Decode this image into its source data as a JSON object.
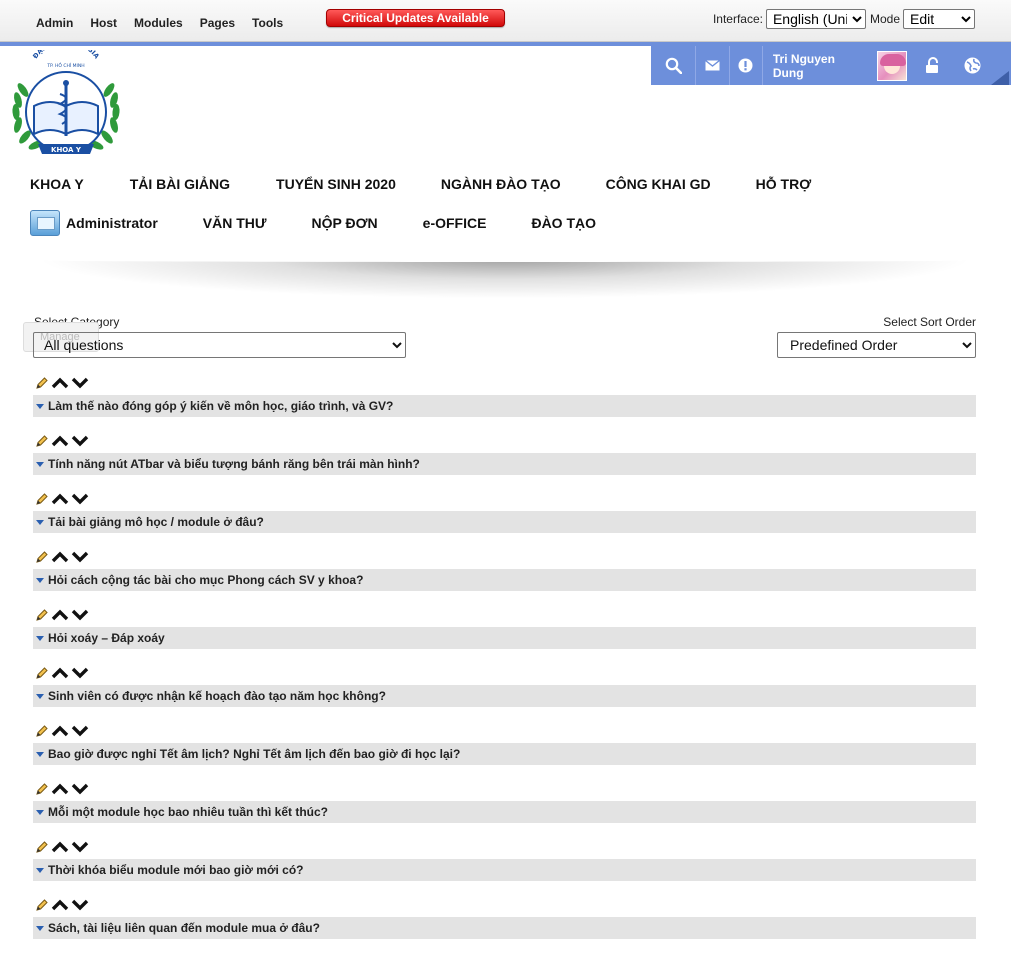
{
  "control_bar": {
    "menu": [
      "Admin",
      "Host",
      "Modules",
      "Pages",
      "Tools"
    ],
    "critical_updates": "Critical Updates Available",
    "interface_label": "Interface:",
    "interface_value": "English (Unit",
    "mode_label": "Mode",
    "mode_value": "Edit"
  },
  "user_bar": {
    "user_name": "Tri Nguyen Dung",
    "icons": [
      "search-icon",
      "mail-icon",
      "alert-icon",
      "lock-icon",
      "globe-icon"
    ],
    "color": "#6d8fdb"
  },
  "logo": {
    "top_text": "ĐẠI HỌC QUỐC GIA",
    "sub_text": "TP. HỒ CHÍ MINH",
    "ribbon_text": "KHOA Y"
  },
  "nav": {
    "row1": [
      "KHOA Y",
      "TẢI BÀI GIẢNG",
      "TUYỂN SINH 2020",
      "NGÀNH ĐÀO TẠO",
      "CÔNG KHAI GD",
      "HỖ TRỢ"
    ],
    "row2": [
      "Administrator",
      "VĂN THƯ",
      "NỘP ĐƠN",
      "e-OFFICE",
      "ĐÀO TẠO"
    ]
  },
  "filters": {
    "category_label": "Select Category",
    "category_value": "All questions",
    "sort_label": "Select Sort Order",
    "sort_value": "Predefined Order",
    "manage_ghost": "Manage"
  },
  "faq": {
    "questions": [
      "Làm thế nào đóng góp ý kiến về môn học, giáo trình, và GV?",
      "Tính năng nút ATbar và biểu tượng bánh răng bên trái màn hình?",
      "Tải bài giảng mô học / module ở đâu?",
      "Hỏi cách cộng tác bài cho mục Phong cách SV y khoa?",
      "Hỏi xoáy – Đáp xoáy",
      "Sinh viên có được nhận kế hoạch đào tạo năm học không?",
      "Bao giờ được nghỉ Tết âm lịch? Nghỉ Tết âm lịch đến bao giờ đi học lại?",
      "Mỗi một module học bao nhiêu tuần thì kết thúc?",
      "Thời khóa biểu module mới bao giờ mới có?",
      "Sách, tài liệu liên quan đến module mua ở đâu?"
    ]
  }
}
